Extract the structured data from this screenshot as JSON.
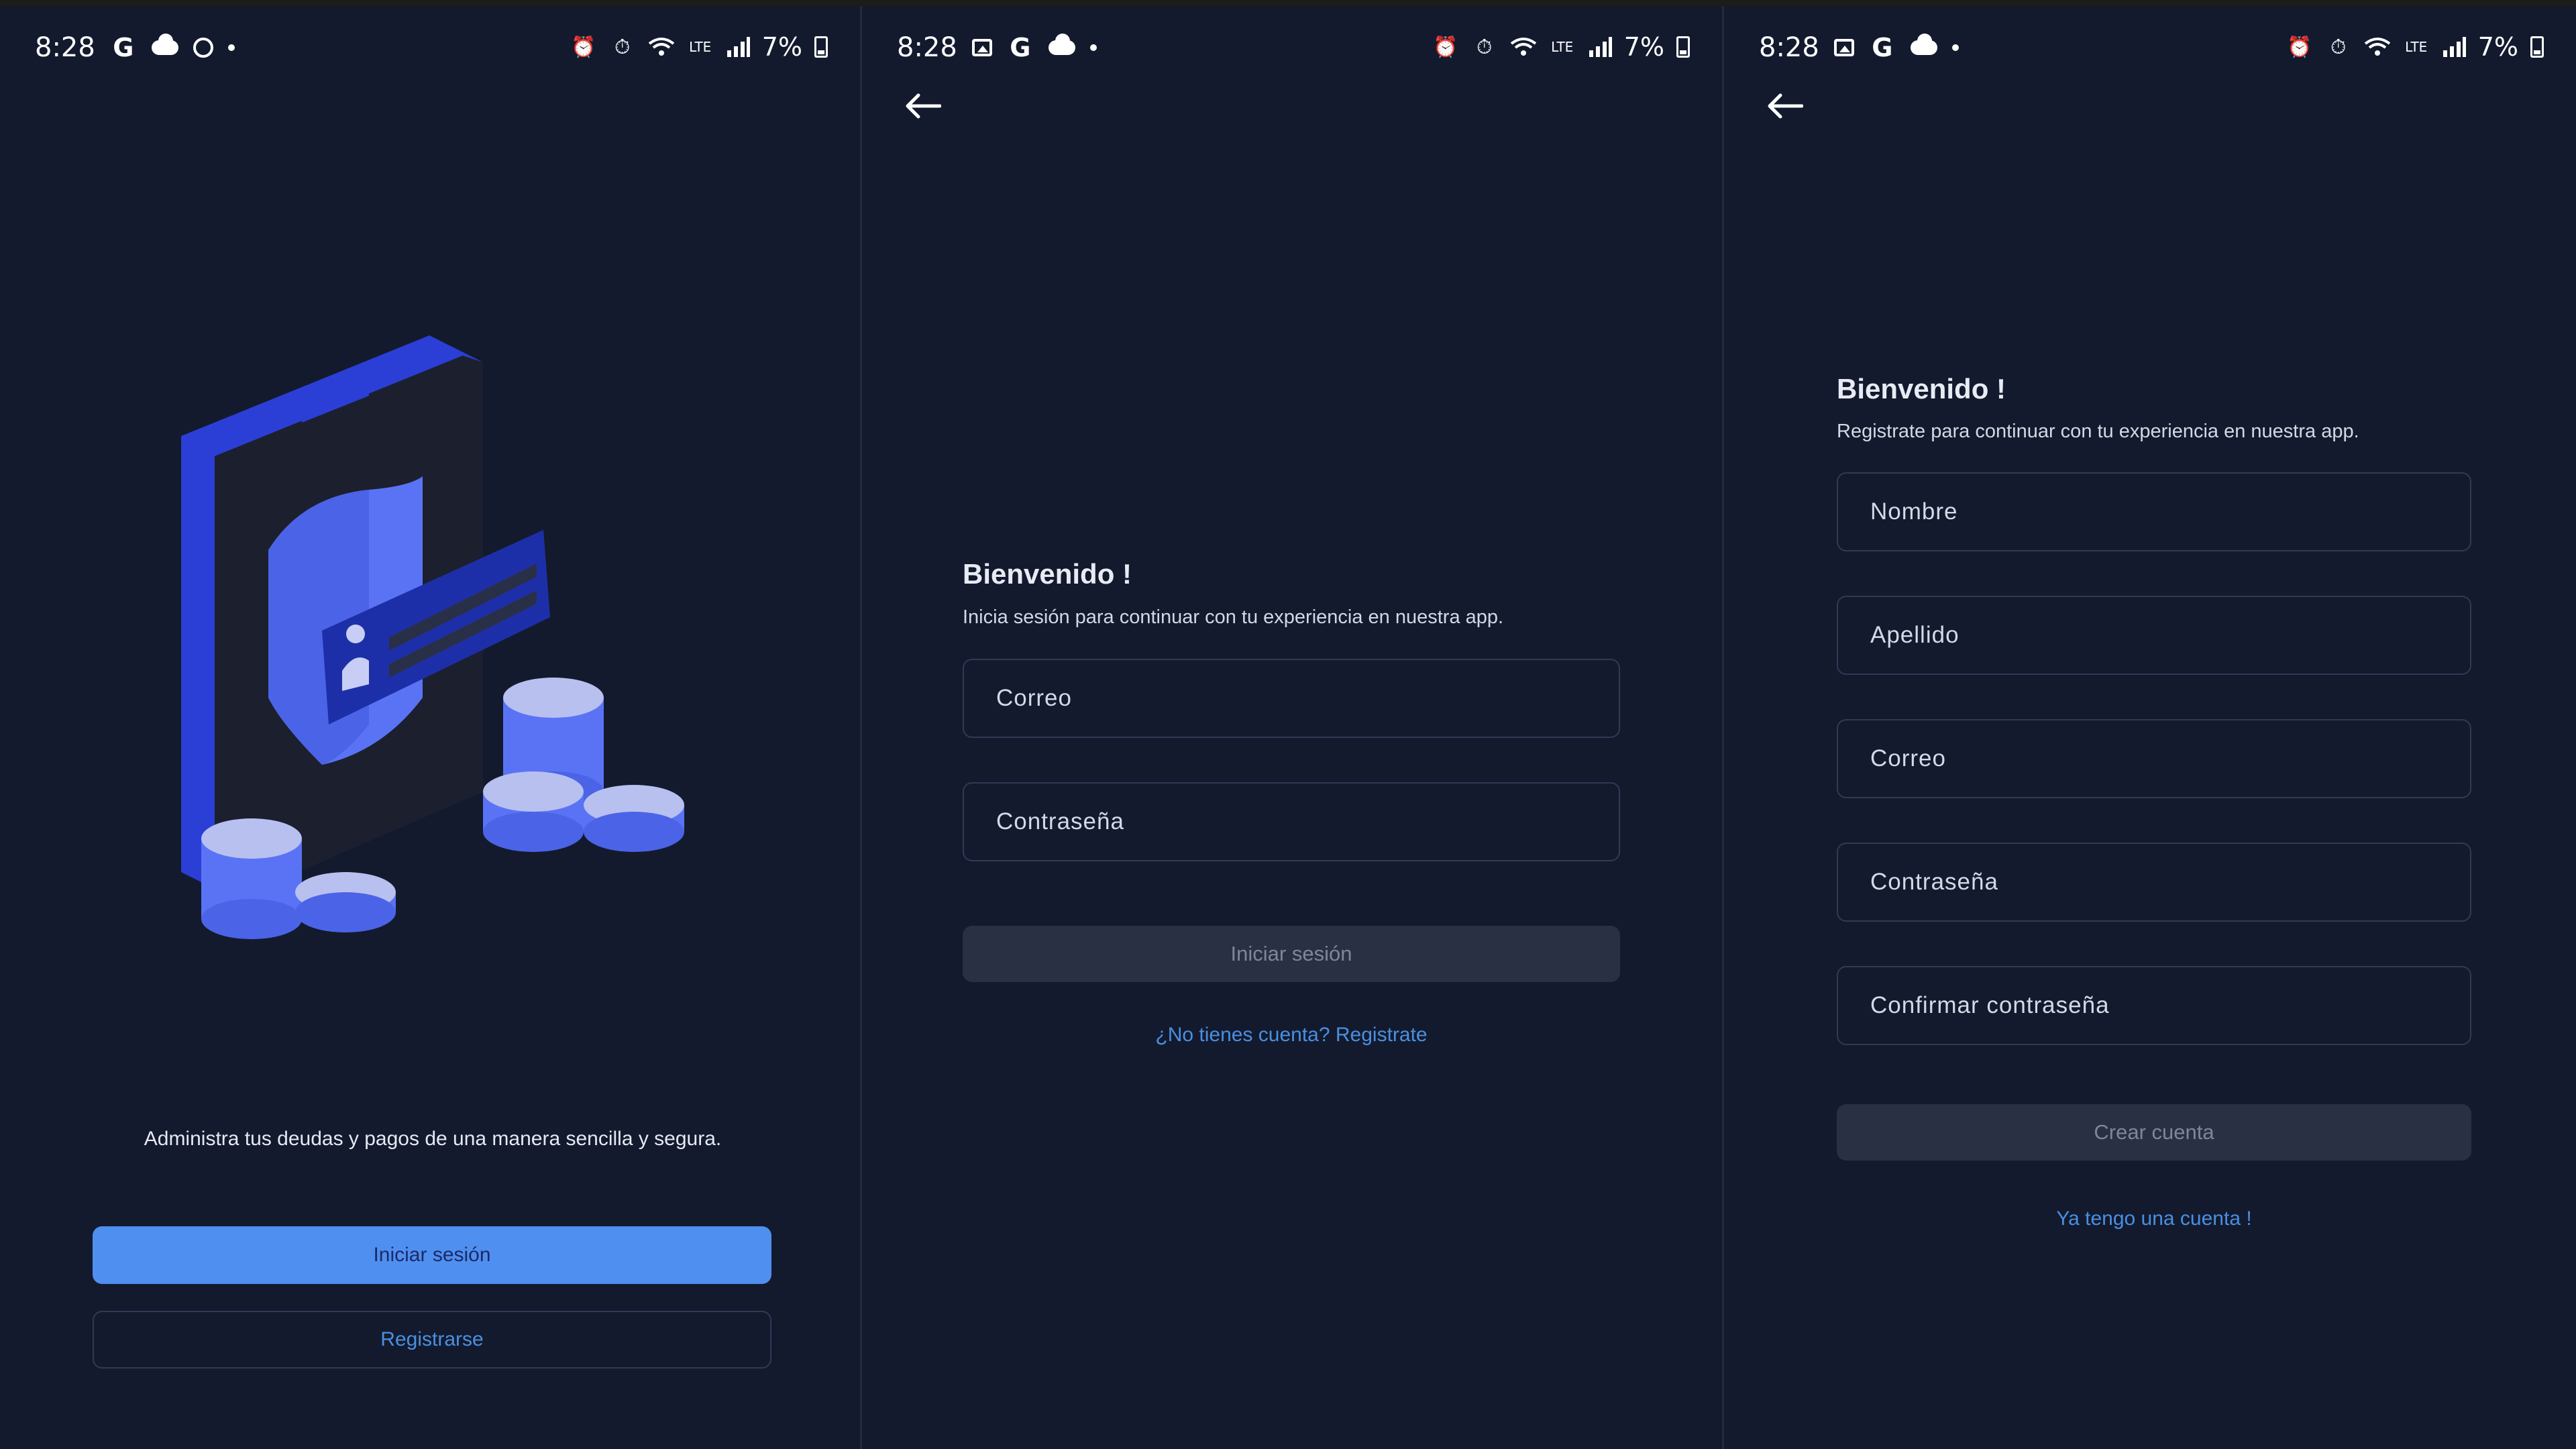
{
  "status_bar": {
    "time": "8:28",
    "battery": "7%",
    "icons_screen1": [
      "google-icon",
      "cloud-icon",
      "whatsapp-icon",
      "dot-icon"
    ],
    "icons_screen23": [
      "image-icon",
      "google-icon",
      "cloud-icon",
      "dot-icon"
    ],
    "right_icons": [
      "alarm-clock-icon",
      "alarm-icon",
      "wifi-icon",
      "lte-icon",
      "signal-icon",
      "battery-icon"
    ]
  },
  "welcome": {
    "tagline": "Administra tus deudas y pagos de una manera sencilla y segura.",
    "login_button": "Iniciar sesión",
    "register_button": "Registrarse"
  },
  "login": {
    "title": "Bienvenido !",
    "subtitle": "Inicia sesión para continuar con tu experiencia en nuestra app.",
    "email_placeholder": "Correo",
    "password_placeholder": "Contraseña",
    "submit_button": "Iniciar sesión",
    "register_link": "¿No tienes cuenta? Registrate"
  },
  "register": {
    "title": "Bienvenido !",
    "subtitle": "Registrate para continuar con tu experiencia en nuestra app.",
    "first_name_placeholder": "Nombre",
    "last_name_placeholder": "Apellido",
    "email_placeholder": "Correo",
    "password_placeholder": "Contraseña",
    "confirm_password_placeholder": "Confirmar contraseña",
    "submit_button": "Crear cuenta",
    "login_link": "Ya tengo una cuenta !"
  },
  "colors": {
    "background": "#131a2e",
    "primary": "#4f8ff0",
    "link": "#4a8fe0",
    "disabled_button": "#2a3043",
    "field_border": "#2f3a55"
  }
}
